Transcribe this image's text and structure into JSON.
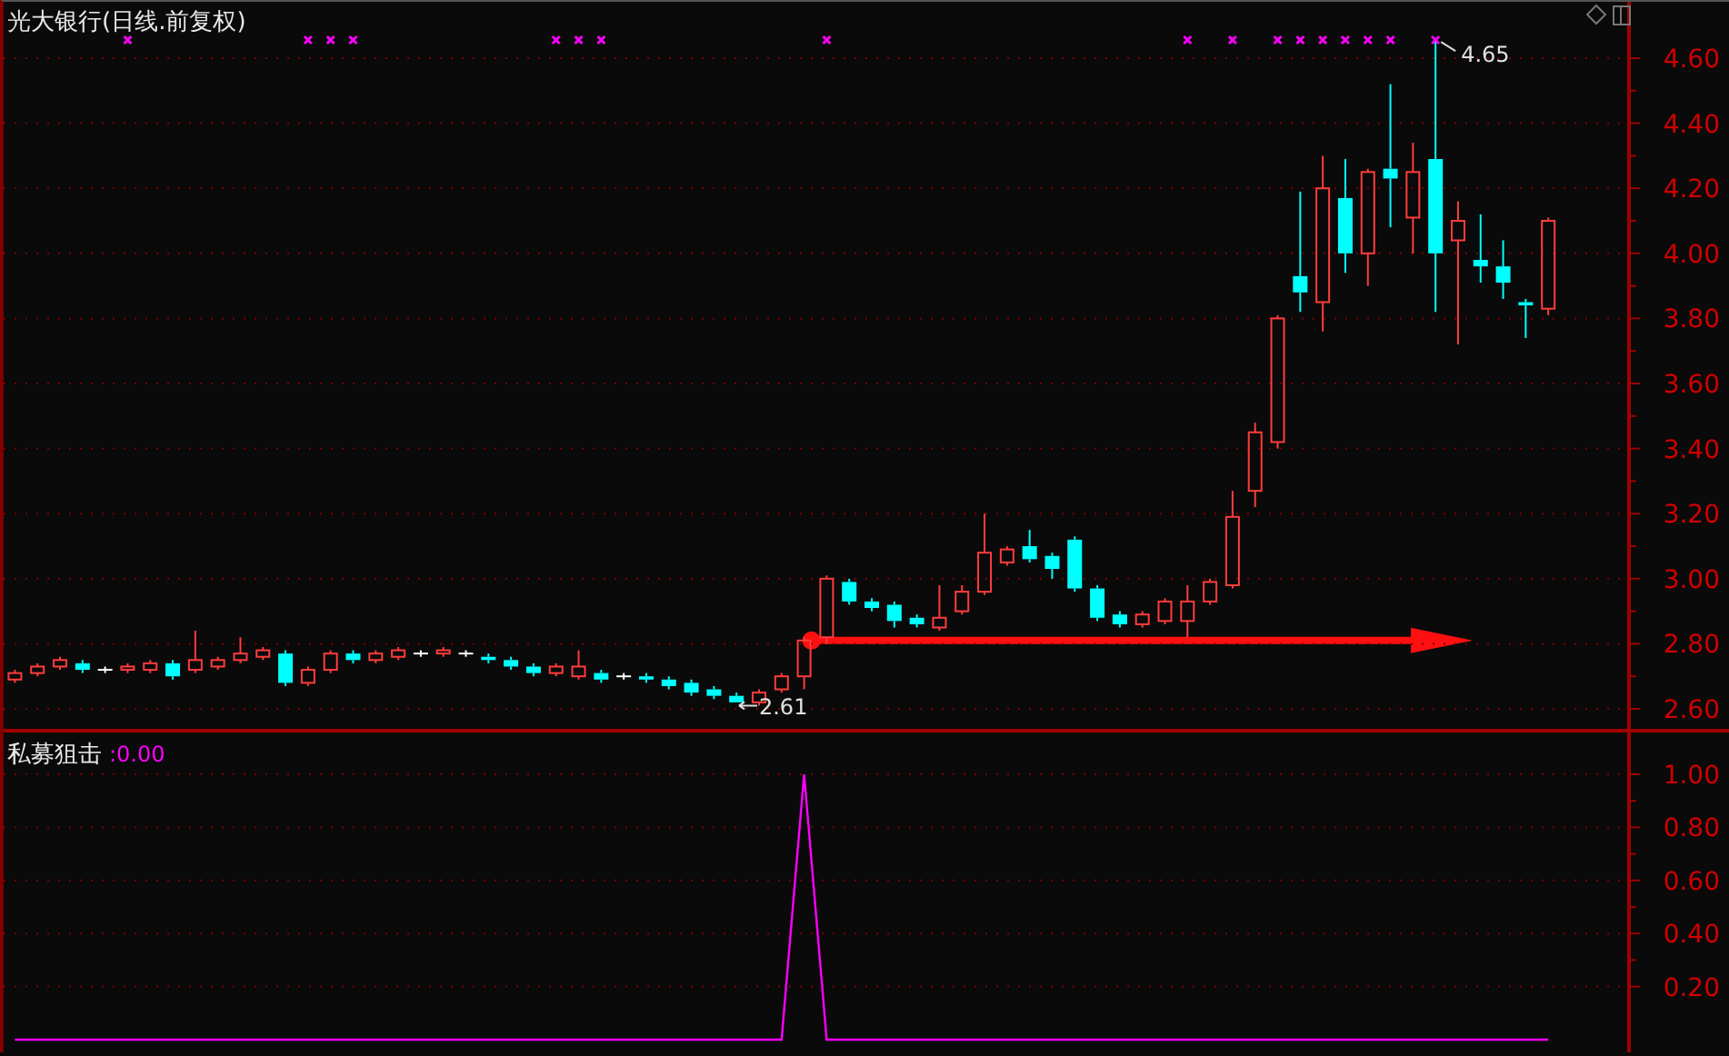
{
  "main_chart": {
    "title": "光大银行(日线.前复权)",
    "signal_flags": [
      false,
      false,
      false,
      false,
      false,
      true,
      false,
      false,
      false,
      false,
      false,
      false,
      false,
      true,
      true,
      true,
      false,
      false,
      false,
      false,
      false,
      false,
      false,
      false,
      true,
      true,
      true,
      false,
      false,
      false,
      false,
      false,
      false,
      false,
      false,
      false,
      true,
      false,
      false,
      false,
      false,
      false,
      false,
      false,
      false,
      false,
      false,
      false,
      false,
      false,
      false,
      false,
      true,
      false,
      true,
      false,
      true,
      true,
      true,
      true,
      true,
      true,
      false,
      true,
      false,
      false,
      false,
      false,
      false
    ],
    "chart_data": {
      "type": "candlestick",
      "grid": true,
      "ylim": [
        2.6,
        4.6
      ],
      "yticks": [
        {
          "value": 4.6,
          "label": "4.60"
        },
        {
          "value": 4.4,
          "label": "4.40"
        },
        {
          "value": 4.2,
          "label": "4.20"
        },
        {
          "value": 4.0,
          "label": "4.00"
        },
        {
          "value": 3.8,
          "label": "3.80"
        },
        {
          "value": 3.6,
          "label": "3.60"
        },
        {
          "value": 3.4,
          "label": "3.40"
        },
        {
          "value": 3.2,
          "label": "3.20"
        },
        {
          "value": 3.0,
          "label": "3.00"
        },
        {
          "value": 2.8,
          "label": "2.80"
        },
        {
          "value": 2.6,
          "label": "2.60"
        }
      ],
      "categories": [
        null,
        null,
        null,
        null,
        null,
        null,
        null,
        null,
        null,
        null,
        null,
        null,
        null,
        null,
        null,
        null,
        null,
        null,
        null,
        null,
        null,
        null,
        null,
        null,
        null,
        null,
        null,
        null,
        null,
        null,
        null,
        null,
        null,
        null,
        null,
        null,
        null,
        null,
        null,
        null,
        null,
        null,
        null,
        null,
        null,
        null,
        null,
        null,
        null,
        null,
        null,
        null,
        null,
        null,
        null,
        null,
        null,
        null,
        null,
        null,
        null,
        null,
        null,
        null,
        null,
        null,
        null,
        null,
        null,
        null,
        null,
        null
      ],
      "ohlc": [
        [
          2.69,
          2.72,
          2.68,
          2.71
        ],
        [
          2.71,
          2.74,
          2.7,
          2.73
        ],
        [
          2.73,
          2.76,
          2.72,
          2.75
        ],
        [
          2.74,
          2.75,
          2.71,
          2.72
        ],
        [
          2.72,
          2.73,
          2.71,
          2.72
        ],
        [
          2.72,
          2.74,
          2.71,
          2.73
        ],
        [
          2.72,
          2.75,
          2.71,
          2.74
        ],
        [
          2.74,
          2.75,
          2.69,
          2.7
        ],
        [
          2.72,
          2.84,
          2.71,
          2.75
        ],
        [
          2.73,
          2.76,
          2.72,
          2.75
        ],
        [
          2.75,
          2.82,
          2.74,
          2.77
        ],
        [
          2.76,
          2.79,
          2.75,
          2.78
        ],
        [
          2.77,
          2.78,
          2.67,
          2.68
        ],
        [
          2.68,
          2.73,
          2.67,
          2.72
        ],
        [
          2.72,
          2.78,
          2.71,
          2.77
        ],
        [
          2.77,
          2.78,
          2.74,
          2.75
        ],
        [
          2.75,
          2.78,
          2.74,
          2.77
        ],
        [
          2.76,
          2.79,
          2.75,
          2.78
        ],
        [
          2.77,
          2.78,
          2.76,
          2.77
        ],
        [
          2.77,
          2.79,
          2.76,
          2.78
        ],
        [
          2.77,
          2.78,
          2.76,
          2.77
        ],
        [
          2.76,
          2.77,
          2.74,
          2.75
        ],
        [
          2.75,
          2.76,
          2.72,
          2.73
        ],
        [
          2.73,
          2.74,
          2.7,
          2.71
        ],
        [
          2.71,
          2.74,
          2.7,
          2.73
        ],
        [
          2.7,
          2.78,
          2.69,
          2.73
        ],
        [
          2.71,
          2.72,
          2.68,
          2.69
        ],
        [
          2.7,
          2.71,
          2.69,
          2.7
        ],
        [
          2.7,
          2.71,
          2.68,
          2.69
        ],
        [
          2.69,
          2.7,
          2.66,
          2.67
        ],
        [
          2.68,
          2.69,
          2.64,
          2.65
        ],
        [
          2.66,
          2.67,
          2.63,
          2.64
        ],
        [
          2.64,
          2.65,
          2.62,
          2.62
        ],
        [
          2.62,
          2.66,
          2.61,
          2.65
        ],
        [
          2.66,
          2.71,
          2.65,
          2.7
        ],
        [
          2.7,
          2.82,
          2.66,
          2.81
        ],
        [
          2.82,
          3.01,
          2.8,
          3.0
        ],
        [
          2.99,
          3.0,
          2.92,
          2.93
        ],
        [
          2.93,
          2.94,
          2.9,
          2.91
        ],
        [
          2.92,
          2.93,
          2.85,
          2.87
        ],
        [
          2.88,
          2.89,
          2.85,
          2.86
        ],
        [
          2.85,
          2.98,
          2.84,
          2.88
        ],
        [
          2.9,
          2.98,
          2.89,
          2.96
        ],
        [
          2.96,
          3.2,
          2.95,
          3.08
        ],
        [
          3.05,
          3.1,
          3.04,
          3.09
        ],
        [
          3.1,
          3.15,
          3.05,
          3.06
        ],
        [
          3.07,
          3.08,
          3.0,
          3.03
        ],
        [
          3.12,
          3.13,
          2.96,
          2.97
        ],
        [
          2.97,
          2.98,
          2.87,
          2.88
        ],
        [
          2.89,
          2.9,
          2.85,
          2.86
        ],
        [
          2.86,
          2.9,
          2.85,
          2.89
        ],
        [
          2.87,
          2.94,
          2.86,
          2.93
        ],
        [
          2.87,
          2.98,
          2.82,
          2.93
        ],
        [
          2.93,
          3.0,
          2.92,
          2.99
        ],
        [
          2.98,
          3.27,
          2.97,
          3.19
        ],
        [
          3.27,
          3.48,
          3.22,
          3.45
        ],
        [
          3.42,
          3.81,
          3.4,
          3.8
        ],
        [
          3.93,
          4.19,
          3.82,
          3.88
        ],
        [
          3.85,
          4.3,
          3.76,
          4.2
        ],
        [
          4.17,
          4.29,
          3.94,
          4.0
        ],
        [
          4.0,
          4.26,
          3.9,
          4.25
        ],
        [
          4.26,
          4.52,
          4.08,
          4.23
        ],
        [
          4.11,
          4.34,
          4.0,
          4.25
        ],
        [
          4.29,
          4.65,
          3.82,
          4.0
        ],
        [
          4.04,
          4.16,
          3.72,
          4.1
        ],
        [
          3.98,
          4.12,
          3.91,
          3.96
        ],
        [
          3.96,
          4.04,
          3.86,
          3.91
        ],
        [
          3.85,
          3.86,
          3.74,
          3.84
        ],
        [
          3.83,
          4.11,
          3.81,
          4.1
        ],
        null,
        null,
        null
      ],
      "annotations": [
        "4.65",
        "2.61"
      ]
    }
  },
  "indicator": {
    "value": ":0.00",
    "chart_data": {
      "type": "line",
      "grid": true,
      "ylim": [
        -0.048,
        1.0
      ],
      "categories": [
        null,
        null,
        null,
        null,
        null,
        null,
        null,
        null,
        null,
        null,
        null,
        null,
        null,
        null,
        null,
        null,
        null,
        null,
        null,
        null,
        null,
        null,
        null,
        null,
        null,
        null,
        null,
        null,
        null,
        null,
        null,
        null,
        null,
        null,
        null,
        null,
        null,
        null,
        null,
        null,
        null,
        null,
        null,
        null,
        null,
        null,
        null,
        null,
        null,
        null,
        null,
        null,
        null,
        null,
        null,
        null,
        null,
        null,
        null,
        null,
        null,
        null,
        null,
        null,
        null,
        null,
        null,
        null,
        null,
        null,
        null,
        null
      ],
      "yticks": [
        {
          "value": 1.0,
          "label": "1.00"
        },
        {
          "value": 0.8,
          "label": "0.80"
        },
        {
          "value": 0.6,
          "label": "0.60"
        },
        {
          "value": 0.4,
          "label": "0.40"
        },
        {
          "value": 0.2,
          "label": "0.20"
        }
      ],
      "series": [
        {
          "name": "私募狙击",
          "color": "#ff00ff",
          "values": [
            0,
            0,
            0,
            0,
            0,
            0,
            0,
            0,
            0,
            0,
            0,
            0,
            0,
            0,
            0,
            0,
            0,
            0,
            0,
            0,
            0,
            0,
            0,
            0,
            0,
            0,
            0,
            0,
            0,
            0,
            0,
            0,
            0,
            0,
            0,
            1,
            0,
            0,
            0,
            0,
            0,
            0,
            0,
            0,
            0,
            0,
            0,
            0,
            0,
            0,
            0,
            0,
            0,
            0,
            0,
            0,
            0,
            0,
            0,
            0,
            0,
            0,
            0,
            0,
            0,
            0,
            0,
            0,
            0,
            null,
            null,
            null
          ]
        }
      ]
    }
  }
}
